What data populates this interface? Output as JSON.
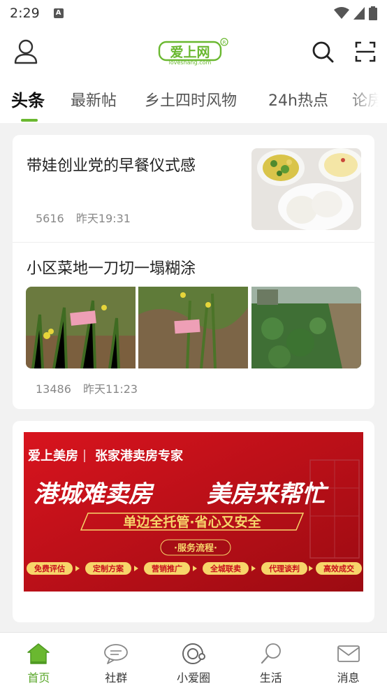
{
  "status_bar": {
    "time": "2:29",
    "notification_icon": "a-icon"
  },
  "header": {
    "logo_text": "爱上网",
    "logo_sub": "loveshang.com",
    "logo_mark": "R"
  },
  "tabs": [
    {
      "label": "头条",
      "active": true
    },
    {
      "label": "最新帖",
      "active": false
    },
    {
      "label": "乡土四时风物",
      "active": false
    },
    {
      "label": "24h热点",
      "active": false
    },
    {
      "label": "论房",
      "active": false
    }
  ],
  "feed": {
    "articles": [
      {
        "title": "带娃创业党的早餐仪式感",
        "views": "5616",
        "time": "昨天19:31"
      },
      {
        "title": "小区菜地一刀切一塌糊涂",
        "views": "13486",
        "time": "昨天11:23"
      }
    ],
    "ad": {
      "brand": "爱上美房",
      "tagline": "张家港卖房专家",
      "headline_left": "港城难卖房",
      "headline_right": "美房来帮忙",
      "subline": "单边全托管·省心又安全",
      "process_title": "·服务流程·",
      "steps": [
        "免费评估",
        "定制方案",
        "营销推广",
        "全城联卖",
        "代理谈判",
        "高效成交"
      ]
    }
  },
  "bottom_nav": [
    {
      "label": "首页",
      "icon": "home-icon",
      "active": true
    },
    {
      "label": "社群",
      "icon": "chat-bubble-icon",
      "active": false
    },
    {
      "label": "小爱圈",
      "icon": "circle-icon",
      "active": false
    },
    {
      "label": "生活",
      "icon": "magnifier-icon",
      "active": false
    },
    {
      "label": "消息",
      "icon": "mail-icon",
      "active": false
    }
  ],
  "colors": {
    "accent": "#6ab830",
    "ad_red": "#c8101c",
    "ad_gold": "#f7d56a"
  }
}
